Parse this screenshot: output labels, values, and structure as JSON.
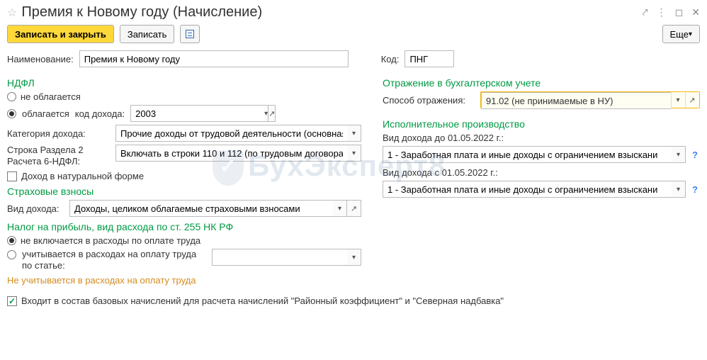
{
  "title": "Премия к Новому году (Начисление)",
  "toolbar": {
    "save_close": "Записать и закрыть",
    "save": "Записать",
    "more": "Еще"
  },
  "name": {
    "label": "Наименование:",
    "value": "Премия к Новому году"
  },
  "code": {
    "label": "Код:",
    "value": "ПНГ"
  },
  "ndfl": {
    "header": "НДФЛ",
    "opt_not_taxed": "не облагается",
    "opt_taxed": "облагается",
    "income_code_label": "код дохода:",
    "income_code_value": "2003",
    "category_label": "Категория дохода:",
    "category_value": "Прочие доходы от трудовой деятельности (основная нал",
    "section2_label": "Строка Раздела 2 Расчета 6-НДФЛ:",
    "section2_value": "Включать в строки 110 и 112 (по трудовым договорам, ко",
    "in_kind": "Доход в натуральной форме"
  },
  "insurance": {
    "header": "Страховые взносы",
    "income_type_label": "Вид дохода:",
    "income_type_value": "Доходы, целиком облагаемые страховыми взносами"
  },
  "profit_tax": {
    "header": "Налог на прибыль, вид расхода по ст. 255 НК РФ",
    "opt_not_included": "не включается в расходы по оплате труда",
    "opt_by_article": "учитывается в расходах на оплату труда по статье:",
    "status": "Не учитывается в расходах на оплату труда"
  },
  "accounting": {
    "header": "Отражение в бухгалтерском учете",
    "method_label": "Способ отражения:",
    "method_value": "91.02 (не принимаемые в НУ)"
  },
  "enforcement": {
    "header": "Исполнительное производство",
    "before_label": "Вид дохода до 01.05.2022 г.:",
    "before_value": "1 - Заработная плата и иные доходы с ограничением взыскани",
    "after_label": "Вид дохода с 01.05.2022 г.:",
    "after_value": "1 - Заработная плата и иные доходы с ограничением взыскани"
  },
  "bottom_check": "Входит в состав базовых начислений для расчета начислений \"Районный коэффициент\" и \"Северная надбавка\"",
  "watermark": "БухЭксперт8"
}
